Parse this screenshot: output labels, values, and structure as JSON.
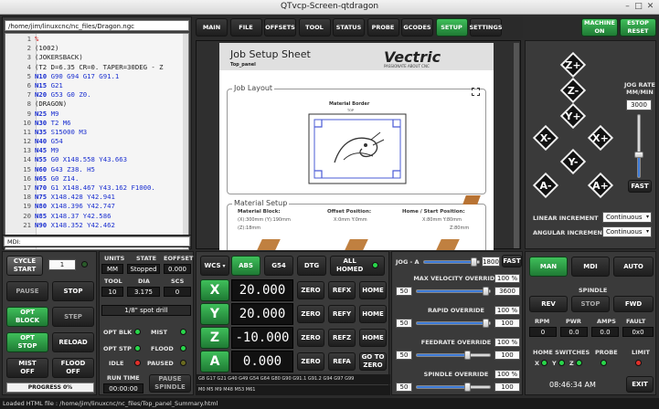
{
  "window": {
    "title": "QTvcp-Screen-qtdragon"
  },
  "editor": {
    "filepath": "/home/jim/linuxcnc/nc_files/Dragon.ngc",
    "lines": [
      {
        "n": "1",
        "a": "",
        "b": "%"
      },
      {
        "n": "2",
        "a": "",
        "b": "(1002)"
      },
      {
        "n": "3",
        "a": "",
        "b": "(JOKERSBACK)"
      },
      {
        "n": "4",
        "a": "",
        "b": "(T2  D=6.35 CR=0. TAPER=30DEG - Z"
      },
      {
        "n": "5",
        "a": "N10",
        "b": " G90 G94 G17 G91.1"
      },
      {
        "n": "6",
        "a": "N15",
        "b": " G21"
      },
      {
        "n": "7",
        "a": "N20",
        "b": " G53 G0 Z0."
      },
      {
        "n": "8",
        "a": "",
        "b": "(DRAGON)"
      },
      {
        "n": "9",
        "a": "N25",
        "b": " M9"
      },
      {
        "n": "10",
        "a": "N30",
        "b": " T2 M6"
      },
      {
        "n": "11",
        "a": "N35",
        "b": " S15000 M3"
      },
      {
        "n": "12",
        "a": "N40",
        "b": " G54"
      },
      {
        "n": "13",
        "a": "N45",
        "b": " M9"
      },
      {
        "n": "14",
        "a": "N55",
        "b": " G0 X148.558 Y43.663"
      },
      {
        "n": "15",
        "a": "N60",
        "b": " G43 Z38. H5"
      },
      {
        "n": "16",
        "a": "N65",
        "b": " G0 Z14."
      },
      {
        "n": "17",
        "a": "N70",
        "b": " G1 X148.467 Y43.162 F1000."
      },
      {
        "n": "18",
        "a": "N75",
        "b": " X148.428 Y42.941"
      },
      {
        "n": "19",
        "a": "N80",
        "b": " X148.396 Y42.747"
      },
      {
        "n": "20",
        "a": "N85",
        "b": " X148.37 Y42.586"
      },
      {
        "n": "21",
        "a": "N90",
        "b": " X148.352 Y42.462"
      }
    ],
    "mdi_label": "MDI:"
  },
  "tabs": [
    "MAIN",
    "FILE",
    "OFFSETS",
    "TOOL",
    "STATUS",
    "PROBE",
    "GCODES",
    "SETUP",
    "SETTINGS"
  ],
  "active_tab": "SETUP",
  "machine_on": "MACHINE\nON",
  "estop_reset": "ESTOP\nRESET",
  "setup_sheet": {
    "title": "Job Setup Sheet",
    "subtitle": "Top_panel",
    "brand": "Vectric",
    "brand_tag": "PASSIONATE ABOUT CNC",
    "job_layout": "Job Layout",
    "material_border": "Material Border",
    "top_label": "TOP",
    "material_setup": "Material Setup",
    "material_block": "Material Block:",
    "block_x": "(X):300mm (Y):190mm",
    "block_z": "(Z):18mm",
    "offset_pos": "Offset Position:",
    "offset_val": "X:0mm Y:0mm",
    "home_pos": "Home / Start Position:",
    "home_val": "X:80mm Y:80mm",
    "home_z": "Z:80mm"
  },
  "jog": {
    "buttons": {
      "zp": "Z+",
      "zm": "Z-",
      "yp": "Y+",
      "ym": "Y-",
      "xm": "X-",
      "xp": "X+",
      "am": "A-",
      "ap": "A+"
    },
    "jog_rate_label": "JOG RATE\nMM/MIN",
    "jog_rate": "3000",
    "jog_rate_frac": 0.35,
    "fast": "FAST",
    "linear_inc_label": "LINEAR INCREMENT",
    "linear_inc": "Continuous",
    "angular_inc_label": "ANGULAR INCREMENT",
    "angular_inc": "Continuous"
  },
  "cycle": {
    "cycle_start": "CYCLE\nSTART",
    "cycle_count": "1",
    "pause": "PAUSE",
    "stop": "STOP",
    "opt_block": "OPT\nBLOCK",
    "step": "STEP",
    "opt_stop": "OPT\nSTOP",
    "reload": "RELOAD",
    "mist_off": "MIST\nOFF",
    "flood_off": "FLOOD\nOFF",
    "progress": "PROGRESS 0%"
  },
  "status": {
    "h_units": "UNITS",
    "h_state": "STATE",
    "h_eoffset": "EOFFSET",
    "units": "MM",
    "state": "Stopped",
    "eoffset": "0.000",
    "h_tool": "TOOL",
    "h_dia": "DIA",
    "h_scs": "SCS",
    "tool": "10",
    "dia": "3.175",
    "scs": "0",
    "tool_desc": "1/8\" spot drill",
    "opt_blk": "OPT BLK",
    "mist": "MIST",
    "opt_stp": "OPT STP",
    "flood": "FLOOD",
    "idle": "IDLE",
    "paused": "PAUSED",
    "run_time_label": "RUN TIME",
    "run_time": "00:00:00",
    "pause_spindle": "PAUSE\nSPINDLE"
  },
  "dro": {
    "wcs": "WCS",
    "abs": "ABS",
    "g54": "G54",
    "dtg": "DTG",
    "all_homed": "ALL\nHOMED",
    "axes": [
      {
        "axis": "X",
        "value": "20.000",
        "ref": "REFX"
      },
      {
        "axis": "Y",
        "value": "20.000",
        "ref": "REFY"
      },
      {
        "axis": "Z",
        "value": "-10.000",
        "ref": "REFZ"
      },
      {
        "axis": "A",
        "value": "0.000",
        "ref": "REFA"
      }
    ],
    "zero": "ZERO",
    "home": "HOME",
    "goto_zero": "GO TO\nZERO",
    "gcodes": "G8 G17 G21 G40 G49 G54 G64 G80 G90 G91.1 G91.2 G94 G97 G99",
    "mcodes": "M0 M5 M9 M48 M53 M61"
  },
  "overrides": {
    "jog_label": "JOG - A",
    "jog_value": "1800",
    "jog_frac": 0.92,
    "fast": "FAST",
    "max_vel_label": "MAX VELOCITY OVERRIDE",
    "max_vel_pct": "100 %",
    "max_vel_low": "50",
    "max_vel_high": "3600",
    "max_vel_frac": 0.95,
    "rapid_label": "RAPID OVERRIDE",
    "rapid_pct": "100 %",
    "rapid_low": "50",
    "rapid_high": "100",
    "rapid_frac": 0.95,
    "feed_label": "FEEDRATE OVERRIDE",
    "feed_pct": "100 %",
    "feed_low": "50",
    "feed_high": "100",
    "feed_frac": 0.7,
    "spindle_label": "SPINDLE OVERRIDE",
    "spindle_pct": "100 %",
    "spindle_low": "50",
    "spindle_high": "100",
    "spindle_frac": 0.7
  },
  "mode": {
    "man": "MAN",
    "mdi": "MDI",
    "auto": "AUTO"
  },
  "spindle": {
    "label": "SPINDLE",
    "rev": "REV",
    "stop": "STOP",
    "fwd": "FWD",
    "rpm_label": "RPM",
    "pwr_label": "PWR",
    "amps_label": "AMPS",
    "fault_label": "FAULT",
    "rpm": "0",
    "pwr": "0.0",
    "amps": "0.0",
    "fault": "0x0",
    "home_switches": "HOME SWITCHES",
    "probe": "PROBE",
    "limit": "LIMIT",
    "x": "X",
    "y": "Y",
    "z": "Z",
    "clock": "08:46:34 AM",
    "exit": "EXIT"
  },
  "statusbar": "Loaded HTML file : /home/jim/linuxcnc/nc_files/Top_panel_Summary.html",
  "colors": {
    "accent_green": "#2fa84a",
    "led_green": "#29d64a",
    "led_red": "#e0302a",
    "gcode_blue": "#1a2fd0"
  }
}
